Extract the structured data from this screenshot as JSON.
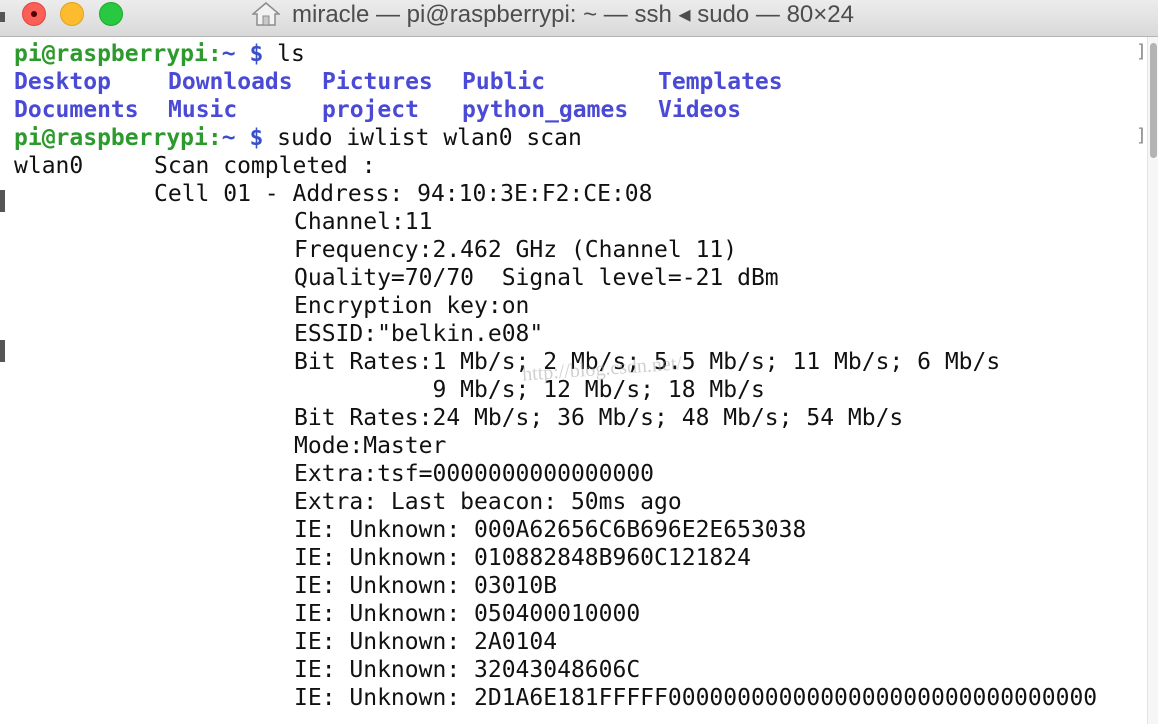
{
  "window": {
    "title": "miracle — pi@raspberrypi: ~ — ssh ◂ sudo — 80×24",
    "title_icon": "home-icon",
    "traffic_lights": {
      "close": "#fc5f57",
      "minimize": "#fdbc2e",
      "zoom": "#28c840"
    }
  },
  "colors": {
    "prompt_user": "#2d9a2d",
    "prompt_path": "#3a50c8",
    "directory": "#4a4ad6",
    "text": "#111111"
  },
  "prompt": {
    "user_host": "pi@raspberrypi",
    "sep": ":",
    "path": "~",
    "symbol": "$"
  },
  "commands": [
    "ls",
    "sudo iwlist wlan0 scan"
  ],
  "ls_output": {
    "row1": [
      "Desktop",
      "Downloads",
      "Pictures",
      "Public",
      "Templates"
    ],
    "row2": [
      "Documents",
      "Music",
      "project",
      "python_games",
      "Videos"
    ]
  },
  "scan": {
    "iface": "wlan0",
    "status": "Scan completed :",
    "cell_label": "Cell 01 - Address: 94:10:3E:F2:CE:08",
    "details": [
      "Channel:11",
      "Frequency:2.462 GHz (Channel 11)",
      "Quality=70/70  Signal level=-21 dBm",
      "Encryption key:on",
      "ESSID:\"belkin.e08\"",
      "Bit Rates:1 Mb/s; 2 Mb/s; 5.5 Mb/s; 11 Mb/s; 6 Mb/s",
      "          9 Mb/s; 12 Mb/s; 18 Mb/s",
      "Bit Rates:24 Mb/s; 36 Mb/s; 48 Mb/s; 54 Mb/s",
      "Mode:Master",
      "Extra:tsf=0000000000000000",
      "Extra: Last beacon: 50ms ago",
      "IE: Unknown: 000A62656C6B696E2E653038",
      "IE: Unknown: 010882848B960C121824",
      "IE: Unknown: 03010B",
      "IE: Unknown: 050400010000",
      "IE: Unknown: 2A0104",
      "IE: Unknown: 32043048606C",
      "IE: Unknown: 2D1A6E181FFFFF0000000000000000000000000000000"
    ]
  },
  "watermark": "http://blog.csdn.net/"
}
